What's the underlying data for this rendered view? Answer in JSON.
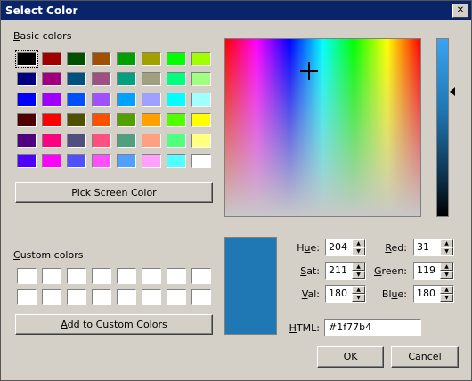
{
  "window": {
    "title": "Select Color",
    "close_symbol": "✕"
  },
  "basic_colors": {
    "label": "Basic colors",
    "swatches": [
      "#000000",
      "#a00000",
      "#005000",
      "#a05000",
      "#00a000",
      "#a0a000",
      "#00ff00",
      "#a0ff00",
      "#000080",
      "#a00080",
      "#005080",
      "#a05080",
      "#00a080",
      "#a0a080",
      "#00ff80",
      "#a0ff80",
      "#0000ff",
      "#a000ff",
      "#0050ff",
      "#a050ff",
      "#00a0ff",
      "#a0a0ff",
      "#00ffff",
      "#a0ffff",
      "#500000",
      "#ff0000",
      "#505000",
      "#ff5000",
      "#50a000",
      "#ffa000",
      "#50ff00",
      "#ffff00",
      "#500080",
      "#ff0080",
      "#505080",
      "#ff5080",
      "#50a080",
      "#ffa080",
      "#50ff80",
      "#ffff80",
      "#5000ff",
      "#ff00ff",
      "#5050ff",
      "#ff50ff",
      "#50a0ff",
      "#ffa0ff",
      "#50ffff",
      "#ffffff"
    ]
  },
  "pick_screen_color": "Pick Screen Color",
  "custom_colors": {
    "label": "Custom colors",
    "count": 16
  },
  "add_to_custom": "Add to Custom Colors",
  "current_color": "#1f77b4",
  "fields": {
    "hue": {
      "label": "Hue:",
      "value": "204"
    },
    "sat": {
      "label": "Sat:",
      "value": "211"
    },
    "val": {
      "label": "Val:",
      "value": "180"
    },
    "red": {
      "label": "Red:",
      "value": "31"
    },
    "green": {
      "label": "Green:",
      "value": "119"
    },
    "blue": {
      "label": "Blue:",
      "value": "180"
    },
    "html": {
      "label": "HTML:",
      "value": "#1f77b4"
    }
  },
  "buttons": {
    "ok": "OK",
    "cancel": "Cancel"
  }
}
